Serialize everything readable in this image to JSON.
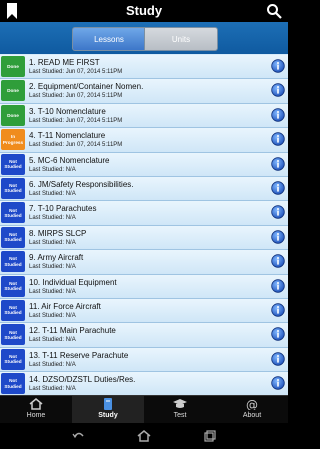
{
  "header": {
    "title": "Study"
  },
  "segments": {
    "lessons": "Lessons",
    "units": "Units",
    "selected": "Lessons"
  },
  "items": [
    {
      "title": "1. READ ME FIRST",
      "studied": "Last Studied: Jun 07, 2014 5:11PM",
      "status": "Done",
      "status_type": "done"
    },
    {
      "title": "2. Equipment/Container Nomen.",
      "studied": "Last Studied: Jun 07, 2014 5:11PM",
      "status": "Done",
      "status_type": "done"
    },
    {
      "title": "3. T-10 Nomenclature",
      "studied": "Last Studied: Jun 07, 2014 5:11PM",
      "status": "Done",
      "status_type": "done"
    },
    {
      "title": "4. T-11 Nomenclature",
      "studied": "Last Studied: Jun 07, 2014 5:11PM",
      "status": "In Progress",
      "status_type": "inprog"
    },
    {
      "title": "5. MC-6 Nomenclature",
      "studied": "Last Studied: N/A",
      "status": "Not Studied",
      "status_type": "not"
    },
    {
      "title": "6. JM/Safety Responsibilities.",
      "studied": "Last Studied: N/A",
      "status": "Not Studied",
      "status_type": "not"
    },
    {
      "title": "7. T-10 Parachutes",
      "studied": "Last Studied: N/A",
      "status": "Not Studied",
      "status_type": "not"
    },
    {
      "title": "8. MIRPS SLCP",
      "studied": "Last Studied: N/A",
      "status": "Not Studied",
      "status_type": "not"
    },
    {
      "title": "9. Army Aircraft",
      "studied": "Last Studied: N/A",
      "status": "Not Studied",
      "status_type": "not"
    },
    {
      "title": "10. Individual Equipment",
      "studied": "Last Studied: N/A",
      "status": "Not Studied",
      "status_type": "not"
    },
    {
      "title": "11. Air Force Aircraft",
      "studied": "Last Studied: N/A",
      "status": "Not Studied",
      "status_type": "not"
    },
    {
      "title": "12. T-11 Main Parachute",
      "studied": "Last Studied: N/A",
      "status": "Not Studied",
      "status_type": "not"
    },
    {
      "title": "13. T-11 Reserve Parachute",
      "studied": "Last Studied: N/A",
      "status": "Not Studied",
      "status_type": "not"
    },
    {
      "title": "14. DZSO/DZSTL Duties/Res.",
      "studied": "Last Studied: N/A",
      "status": "Not Studied",
      "status_type": "not"
    }
  ],
  "tabs": [
    {
      "label": "Home",
      "icon": "home-icon"
    },
    {
      "label": "Study",
      "icon": "book-icon"
    },
    {
      "label": "Test",
      "icon": "graduation-cap-icon"
    },
    {
      "label": "About",
      "icon": "at-icon"
    }
  ],
  "active_tab": "Study",
  "colors": {
    "done": "#2f9e3a",
    "in_progress": "#f08c1d",
    "not_studied": "#1e49c9",
    "header_blue": "#1d6fb6"
  },
  "nav": {
    "icons": [
      "back-icon",
      "home-icon",
      "recent-apps-icon"
    ]
  }
}
